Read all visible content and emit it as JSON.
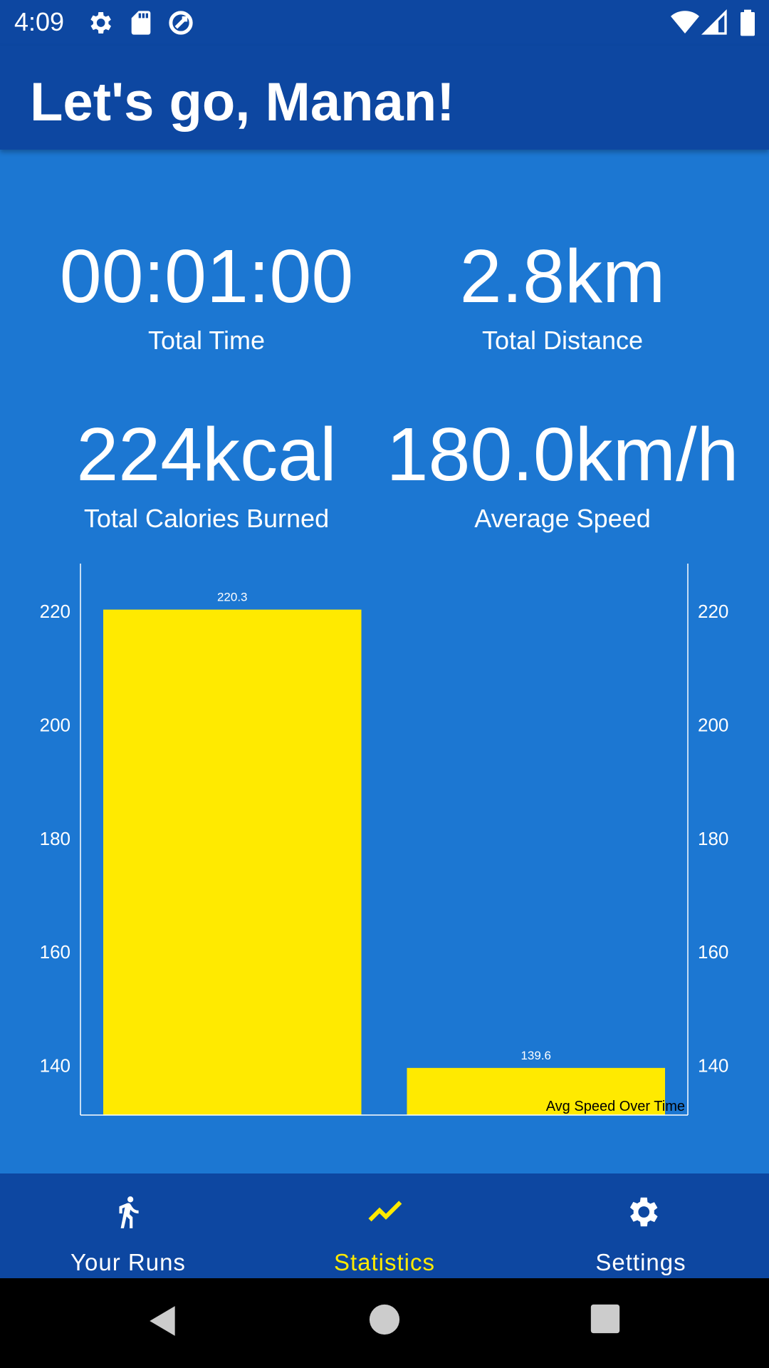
{
  "status_bar": {
    "time": "4:09",
    "left_icons": [
      "gear-icon",
      "sd-card-icon",
      "sync-icon"
    ],
    "right_icons": [
      "wifi-icon",
      "cell-signal-icon",
      "battery-icon"
    ]
  },
  "app_bar": {
    "title": "Let's go, Manan!"
  },
  "stats": {
    "total_time": {
      "value": "00:01:00",
      "label": "Total Time"
    },
    "total_distance": {
      "value": "2.8km",
      "label": "Total Distance"
    },
    "total_calories": {
      "value": "224kcal",
      "label": "Total Calories Burned"
    },
    "average_speed": {
      "value": "180.0km/h",
      "label": "Average Speed"
    }
  },
  "chart_data": {
    "type": "bar",
    "description_label": "Avg Speed Over Time",
    "values": [
      220.3,
      139.6
    ],
    "value_labels": [
      "220.3",
      "139.6"
    ],
    "ylim": [
      131.3,
      228.4
    ],
    "left_ticks": [
      140,
      160,
      180,
      200,
      220
    ],
    "right_ticks": [
      140,
      160,
      180,
      200,
      220
    ],
    "bar_color": "#ffea00",
    "axis_color": "#ffffff"
  },
  "bottom_nav": {
    "items": [
      {
        "label": "Your Runs",
        "icon": "run-icon",
        "active": false
      },
      {
        "label": "Statistics",
        "icon": "trend-line-icon",
        "active": true
      },
      {
        "label": "Settings",
        "icon": "gear-icon",
        "active": false
      }
    ],
    "active_color": "#ffea00"
  },
  "colors": {
    "primary_dark": "#0d47a1",
    "background": "#1c77d2",
    "accent": "#ffea00"
  }
}
